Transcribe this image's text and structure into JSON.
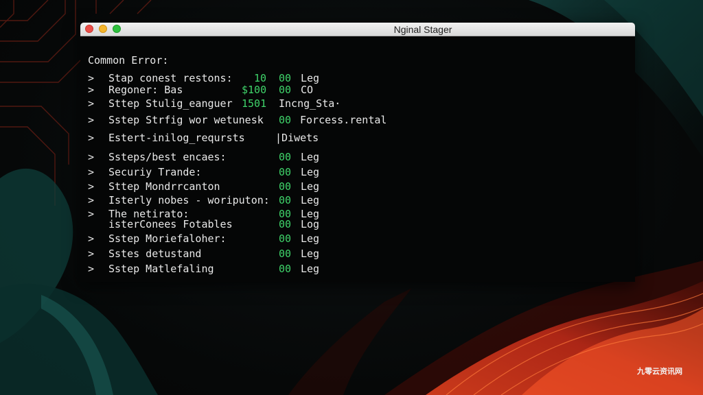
{
  "window": {
    "title": "Nginal Stager"
  },
  "terminal": {
    "heading": "Common Error:",
    "rows": [
      {
        "prompt": ">",
        "label": "Stap conest restons:",
        "mid": "10",
        "code": "00",
        "tail": "Leg"
      },
      {
        "prompt": ">",
        "label": "Regoner: Bas",
        "mid": "$100",
        "code": "00",
        "tail": "CO"
      },
      {
        "prompt": ">",
        "label": "Sttep Stulig_eanguer",
        "mid": "1501",
        "code": "",
        "tail": "Incng_Sta·"
      },
      {
        "prompt": ">",
        "label": "Sstep Strfig wor wetunesk",
        "mid": "",
        "code": "00",
        "tail": "Forcess.rental"
      },
      {
        "prompt": ">",
        "label": "Estert-inilog_reqursts",
        "mid": "",
        "code": "",
        "tail": "|Diwets"
      },
      {
        "prompt": ">",
        "label": "Ssteps/best encaes:",
        "mid": "",
        "code": "00",
        "tail": "Leg"
      },
      {
        "prompt": ">",
        "label": "Securiy Trande:",
        "mid": "",
        "code": "00",
        "tail": "Leg"
      },
      {
        "prompt": ">",
        "label": "Sttep Mondrrcanton",
        "mid": "",
        "code": "00",
        "tail": "Leg"
      },
      {
        "prompt": ">",
        "label": "Isterly nobes - woriputon:",
        "mid": "",
        "code": "00",
        "tail": "Leg"
      },
      {
        "prompt": ">",
        "label": "The netirato:",
        "mid": "",
        "code": "00",
        "tail": "Leg"
      },
      {
        "prompt": "",
        "label": "isterConees Fotables",
        "mid": "",
        "code": "00",
        "tail": "Log"
      },
      {
        "prompt": ">",
        "label": "Sstep Moriefaloher:",
        "mid": "",
        "code": "00",
        "tail": "Leg"
      },
      {
        "prompt": ">",
        "label": "Sstes detustand",
        "mid": "",
        "code": "00",
        "tail": "Leg"
      },
      {
        "prompt": ">",
        "label": "Sstep Matlefaling",
        "mid": "",
        "code": "00",
        "tail": "Leg"
      }
    ]
  },
  "watermark": "九零云资讯网",
  "colors": {
    "terminal_bg": "#050606",
    "terminal_text": "#e9e9e9",
    "status_green": "#3fd46a",
    "titlebar": "#e4e4e4",
    "accent_teal": "#1a6a64",
    "accent_red": "#d8351f"
  }
}
